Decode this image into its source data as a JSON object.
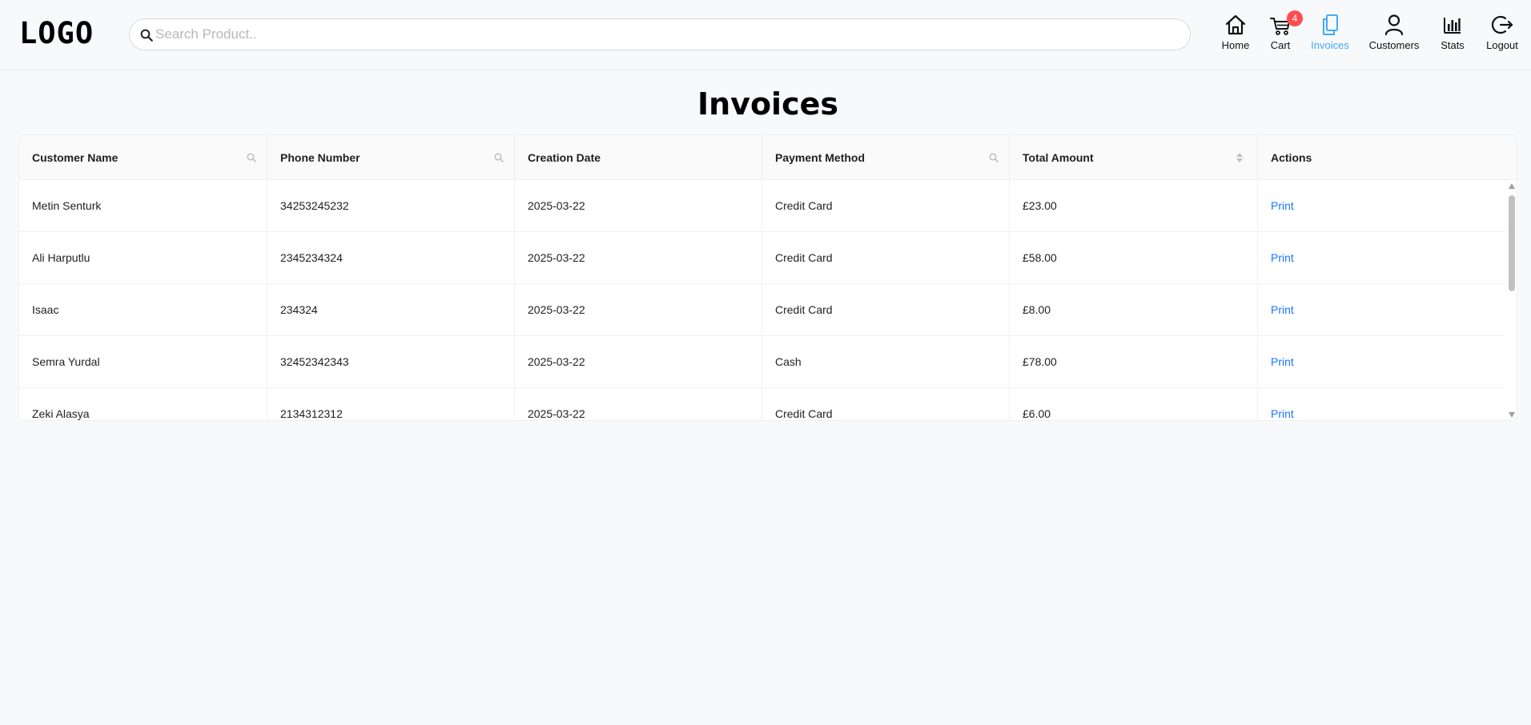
{
  "header": {
    "logo": "LOGO",
    "search": {
      "placeholder": "Search Product..",
      "value": ""
    },
    "nav": [
      {
        "label": "Home",
        "icon": "home-icon"
      },
      {
        "label": "Cart",
        "icon": "cart-icon",
        "badge": "4"
      },
      {
        "label": "Invoices",
        "icon": "invoice-icon",
        "active": true
      },
      {
        "label": "Customers",
        "icon": "user-icon"
      },
      {
        "label": "Stats",
        "icon": "bar-chart-icon"
      },
      {
        "label": "Logout",
        "icon": "logout-icon"
      }
    ]
  },
  "main": {
    "title": "Invoices",
    "table": {
      "columns": [
        "Customer Name",
        "Phone Number",
        "Creation Date",
        "Payment Method",
        "Total Amount",
        "Actions"
      ],
      "rows": [
        {
          "customer": "Metin Senturk",
          "phone": "34253245232",
          "date": "2025-03-22",
          "payment": "Credit Card",
          "total": "£23.00",
          "action": "Print"
        },
        {
          "customer": "Ali Harputlu",
          "phone": "2345234324",
          "date": "2025-03-22",
          "payment": "Credit Card",
          "total": "£58.00",
          "action": "Print"
        },
        {
          "customer": "Isaac",
          "phone": "234324",
          "date": "2025-03-22",
          "payment": "Credit Card",
          "total": "£8.00",
          "action": "Print"
        },
        {
          "customer": "Semra Yurdal",
          "phone": "32452342343",
          "date": "2025-03-22",
          "payment": "Cash",
          "total": "£78.00",
          "action": "Print"
        },
        {
          "customer": "Zeki Alasya",
          "phone": "2134312312",
          "date": "2025-03-22",
          "payment": "Credit Card",
          "total": "£6.00",
          "action": "Print"
        }
      ]
    }
  },
  "colors": {
    "accent": "#40a9ff",
    "link": "#1677ff",
    "badge": "#ff4d4f",
    "background": "#f8f9fb"
  }
}
